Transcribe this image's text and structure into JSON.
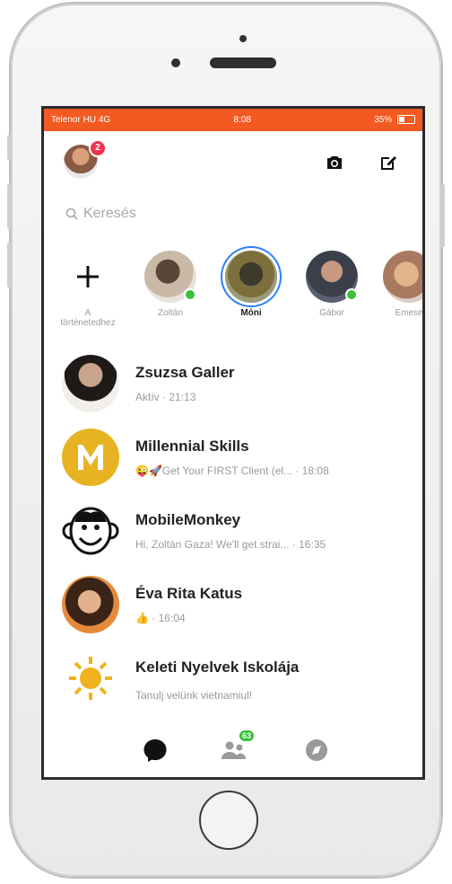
{
  "status_bar": {
    "carrier": "Telenor HU",
    "network": "4G",
    "time": "8:08",
    "battery": "35%"
  },
  "header": {
    "profile_badge": "2"
  },
  "search": {
    "placeholder": "Keresés"
  },
  "stories": [
    {
      "label": "A történetedhez"
    },
    {
      "label": "Zoltán"
    },
    {
      "label": "Móni"
    },
    {
      "label": "Gábor"
    },
    {
      "label": "Emese"
    }
  ],
  "chats": [
    {
      "name": "Zsuzsa Galler",
      "preview": "Aktív ",
      "time": "· 21:13"
    },
    {
      "name": "Millennial Skills",
      "preview": "😜🚀Get Your FIRST Client (el...",
      "time": " · 18:08"
    },
    {
      "name": "MobileMonkey",
      "preview": "Hi, Zoltán Gaza! We'll get strai...",
      "time": " · 16:35"
    },
    {
      "name": "Éva Rita Katus",
      "preview": "👍",
      "time": " · 16:04"
    },
    {
      "name": "Keleti Nyelvek Iskolája",
      "preview": "Tanulj velünk vietnamiul!",
      "time": ""
    }
  ],
  "tabbar": {
    "people_badge": "63"
  },
  "colors": {
    "accent": "#f25a22",
    "messenger_blue": "#2d7ff9",
    "online": "#3bbf3b",
    "badge": "#f0344f"
  },
  "icons": {
    "camera": "camera-icon",
    "compose": "compose-icon",
    "search": "search-icon",
    "add_story": "plus-icon",
    "chats_tab": "chat-bubble-icon",
    "people_tab": "people-icon",
    "discover_tab": "compass-icon"
  }
}
